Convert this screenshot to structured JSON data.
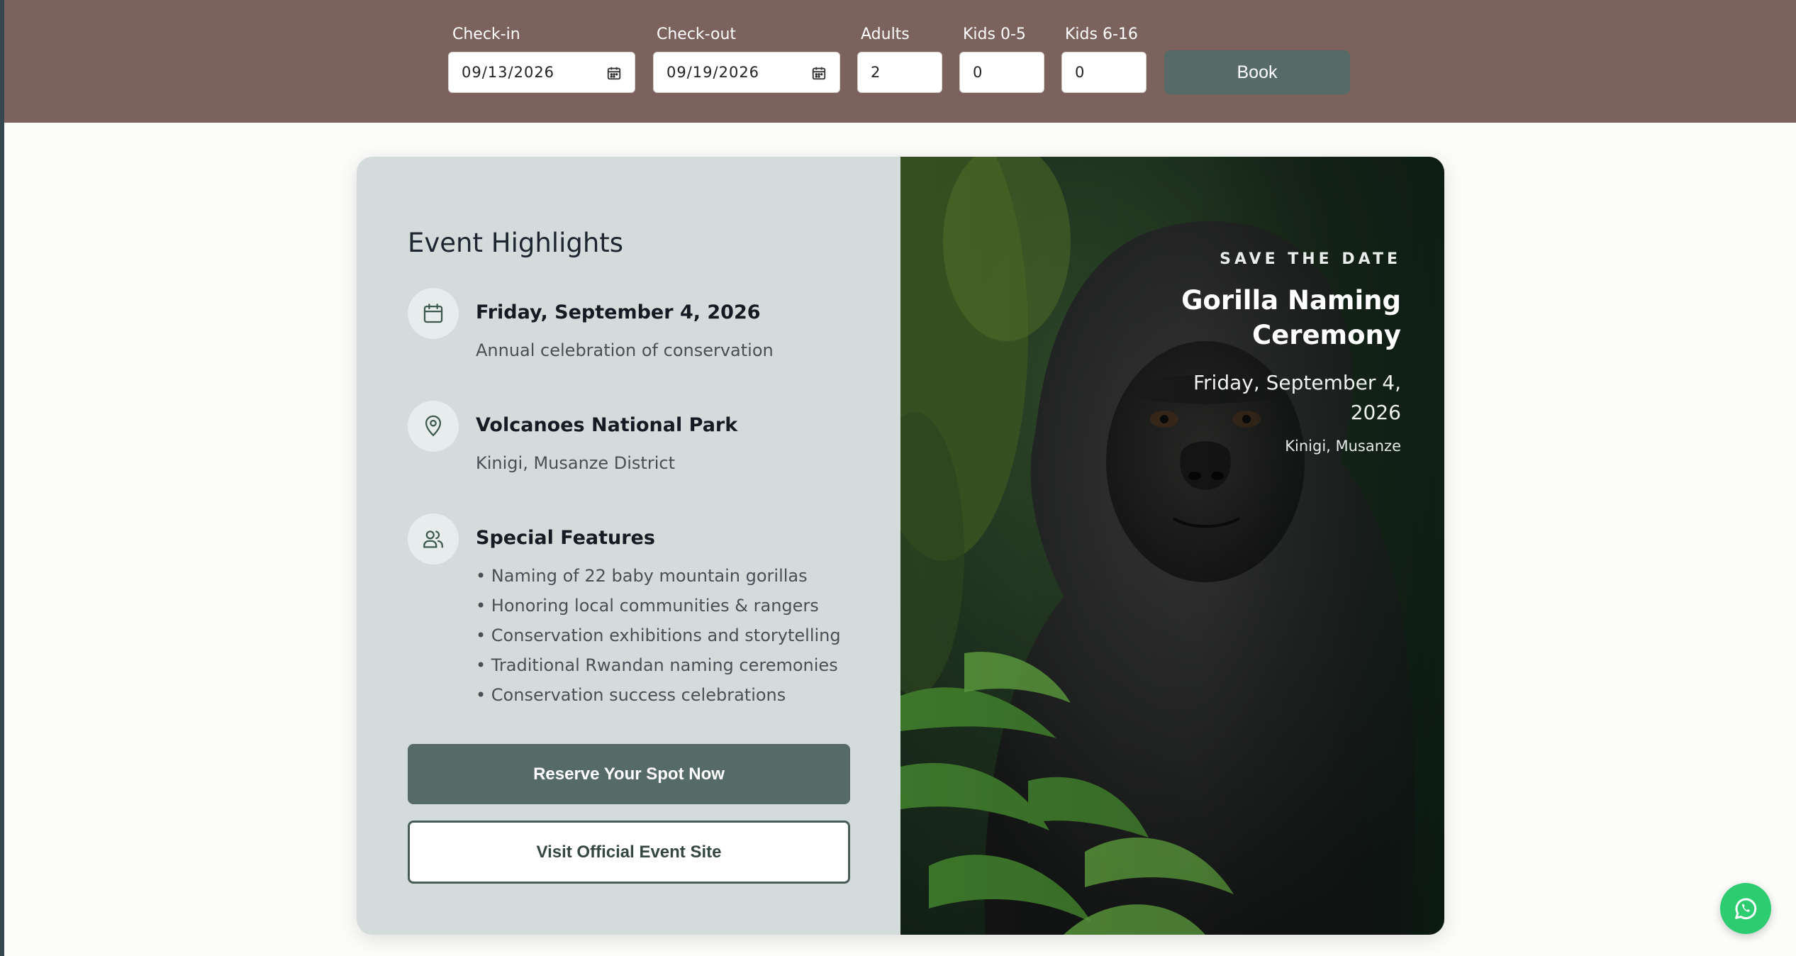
{
  "booking": {
    "checkin_label": "Check-in",
    "checkin_value": "09/13/2026",
    "checkout_label": "Check-out",
    "checkout_value": "09/19/2026",
    "adults_label": "Adults",
    "adults_value": "2",
    "kids05_label": "Kids 0-5",
    "kids05_value": "0",
    "kids616_label": "Kids 6-16",
    "kids616_value": "0",
    "book_label": "Book"
  },
  "highlights": {
    "title": "Event Highlights",
    "date_title": "Friday, September 4, 2026",
    "date_sub": "Annual celebration of conservation",
    "place_title": "Volcanoes National Park",
    "place_sub": "Kinigi, Musanze District",
    "features_title": "Special Features",
    "features": [
      "• Naming of 22 baby mountain gorillas",
      "• Honoring local communities & rangers",
      "• Conservation exhibitions and storytelling",
      "• Traditional Rwandan naming ceremonies",
      "• Conservation success celebrations"
    ],
    "reserve_label": "Reserve Your Spot Now",
    "visit_label": "Visit Official Event Site"
  },
  "hero": {
    "save_the_date": "SAVE THE DATE",
    "event_name": "Gorilla Naming Ceremony",
    "event_date": "Friday, September 4, 2026",
    "event_place": "Kinigi, Musanze"
  },
  "icons": {
    "calendar": "calendar-icon",
    "location": "map-pin-icon",
    "features": "users-icon",
    "whatsapp": "whatsapp-icon"
  },
  "colors": {
    "booking_bar": "#7b625c",
    "primary_button": "#566a67",
    "card_left_bg": "#d4dcdb",
    "whatsapp": "#2ecc71"
  }
}
